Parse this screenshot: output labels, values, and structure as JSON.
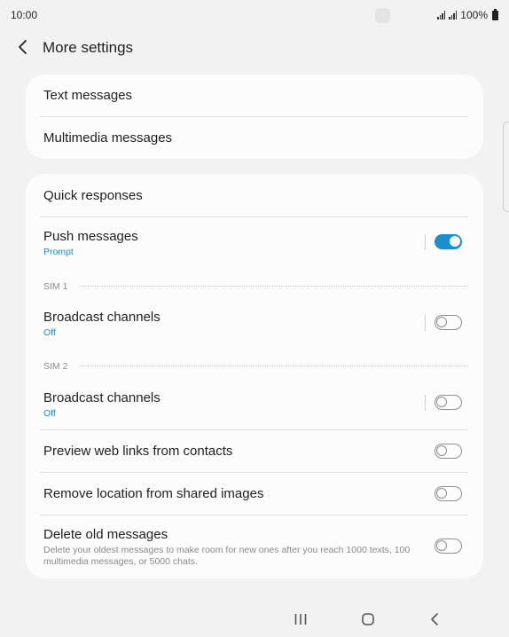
{
  "status_bar": {
    "time": "10:00",
    "battery_text": "100%"
  },
  "header": {
    "title": "More settings"
  },
  "card_1": {
    "items": [
      {
        "title": "Text messages"
      },
      {
        "title": "Multimedia messages"
      }
    ]
  },
  "card_2": {
    "quick_responses": {
      "title": "Quick responses"
    },
    "push_messages": {
      "title": "Push messages",
      "subtitle": "Prompt",
      "enabled": true
    },
    "sim1": {
      "header": "SIM 1",
      "broadcast": {
        "title": "Broadcast channels",
        "subtitle": "Off",
        "enabled": false
      }
    },
    "sim2": {
      "header": "SIM 2",
      "broadcast": {
        "title": "Broadcast channels",
        "subtitle": "Off",
        "enabled": false
      }
    },
    "preview_links": {
      "title": "Preview web links from contacts",
      "enabled": false
    },
    "remove_location": {
      "title": "Remove location from shared images",
      "enabled": false
    },
    "delete_old": {
      "title": "Delete old messages",
      "description": "Delete your oldest messages to make room for new ones after you reach 1000 texts, 100 multimedia messages, or 5000 chats.",
      "enabled": false
    }
  },
  "nav_bar": {
    "buttons": [
      "recent-apps-icon",
      "home-icon",
      "back-icon"
    ]
  },
  "colors": {
    "accent": "#1a8fcf",
    "background": "#f2f2f2",
    "card": "#fcfcfc"
  }
}
